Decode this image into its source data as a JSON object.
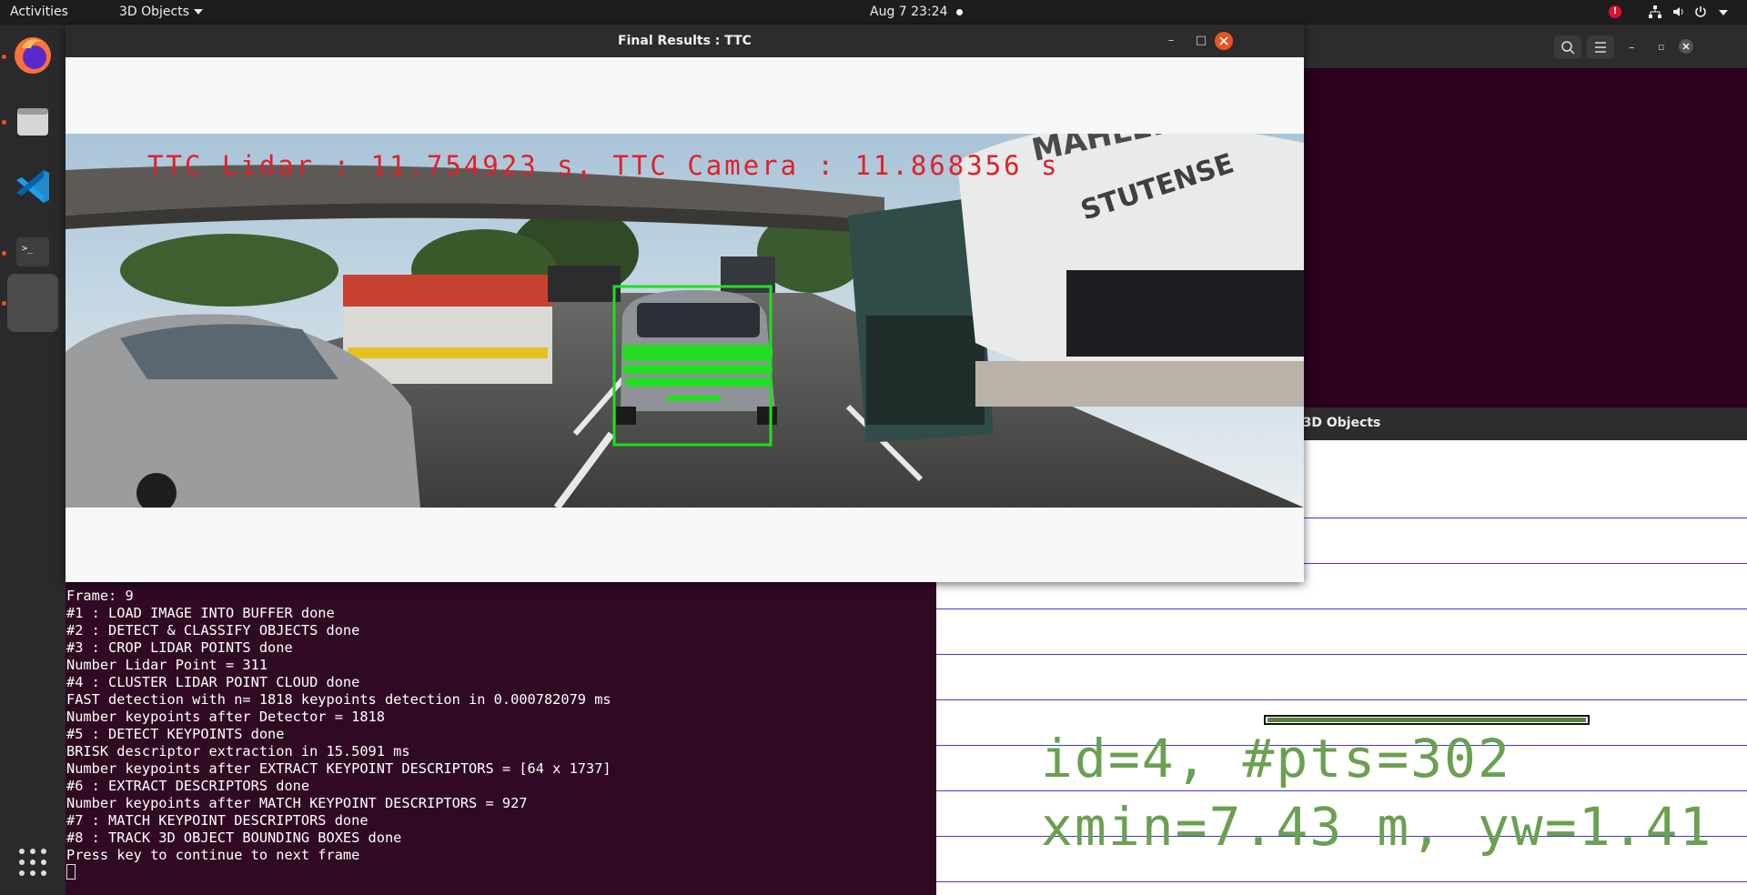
{
  "topbar": {
    "activities": "Activities",
    "app_menu": "3D Objects",
    "clock": "Aug 7  23:24",
    "alert_badge": "!"
  },
  "dock": {
    "apps": [
      "firefox-icon",
      "files-icon",
      "vscode-icon",
      "terminal-icon",
      "active-app-icon"
    ],
    "grid_icon": "show-applications-icon"
  },
  "ttc_window": {
    "title": "Final Results : TTC",
    "overlay_text": "TTC Lidar : 11.754923 s, TTC Camera : 11.868356 s",
    "sign_text": "MAHLER STUTENSE"
  },
  "objects_window": {
    "title": "3D Objects",
    "line1": "id=4, #pts=302",
    "line2": "xmin=7.43 m, yw=1.41"
  },
  "terminal": {
    "lines": [
      "Frame: 9",
      "#1 : LOAD IMAGE INTO BUFFER done",
      "#2 : DETECT & CLASSIFY OBJECTS done",
      "#3 : CROP LIDAR POINTS done",
      "Number Lidar Point = 311",
      "#4 : CLUSTER LIDAR POINT CLOUD done",
      "FAST detection with n= 1818 keypoints detection in 0.000782079 ms",
      "Number keypoints after Detector = 1818",
      "#5 : DETECT KEYPOINTS done",
      "BRISK descriptor extraction in 15.5091 ms",
      "Number keypoints after EXTRACT KEYPOINT DESCRIPTORS = [64 x 1737]",
      "#6 : EXTRACT DESCRIPTORS done",
      "Number keypoints after MATCH KEYPOINT DESCRIPTORS = 927",
      "#7 : MATCH KEYPOINT DESCRIPTORS done",
      "#8 : TRACK 3D OBJECT BOUNDING BOXES done",
      "Press key to continue to next frame"
    ]
  },
  "colors": {
    "desktop": "#2c001e",
    "terminal_bg": "#300a24",
    "accent": "#e95420",
    "overlay_text": "#e0202a",
    "bbox": "#22dd22",
    "grid_line": "#3b3bd6",
    "object_text": "#6aa050"
  }
}
